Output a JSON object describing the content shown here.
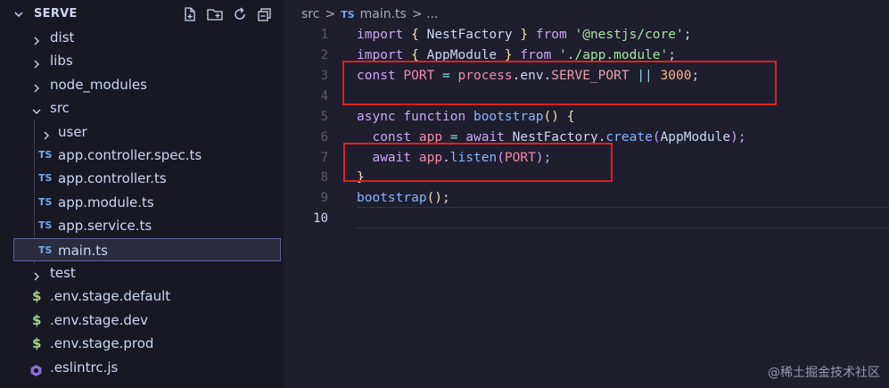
{
  "sidebar": {
    "title": "SERVE",
    "actions": [
      "new-file-icon",
      "new-folder-icon",
      "refresh-icon",
      "collapse-all-icon"
    ],
    "items": [
      {
        "label": "dist",
        "type": "folder",
        "expanded": false,
        "depth": 0
      },
      {
        "label": "libs",
        "type": "folder",
        "expanded": false,
        "depth": 0
      },
      {
        "label": "node_modules",
        "type": "folder",
        "expanded": false,
        "depth": 0
      },
      {
        "label": "src",
        "type": "folder",
        "expanded": true,
        "depth": 0
      },
      {
        "label": "user",
        "type": "folder",
        "expanded": false,
        "depth": 1
      },
      {
        "label": "app.controller.spec.ts",
        "type": "ts",
        "icon": "TS",
        "depth": 1
      },
      {
        "label": "app.controller.ts",
        "type": "ts",
        "icon": "TS",
        "depth": 1
      },
      {
        "label": "app.module.ts",
        "type": "ts",
        "icon": "TS",
        "depth": 1
      },
      {
        "label": "app.service.ts",
        "type": "ts",
        "icon": "TS",
        "depth": 1
      },
      {
        "label": "main.ts",
        "type": "ts",
        "icon": "TS",
        "depth": 1,
        "selected": true
      },
      {
        "label": "test",
        "type": "folder",
        "expanded": false,
        "depth": 0
      },
      {
        "label": ".env.stage.default",
        "type": "env",
        "icon": "$",
        "depth": 0
      },
      {
        "label": ".env.stage.dev",
        "type": "env",
        "icon": "$",
        "depth": 0
      },
      {
        "label": ".env.stage.prod",
        "type": "env",
        "icon": "$",
        "depth": 0
      },
      {
        "label": ".eslintrc.js",
        "type": "eslint",
        "depth": 0
      }
    ]
  },
  "breadcrumb": {
    "part1": "src",
    "sep": ">",
    "file_icon": "TS",
    "file": "main.ts",
    "tail": "> ..."
  },
  "editor": {
    "line_numbers": [
      "1",
      "2",
      "3",
      "4",
      "5",
      "6",
      "7",
      "8",
      "9",
      "10"
    ],
    "active_line": "10",
    "lines": {
      "l1": {
        "t1": "import",
        "t2": "{",
        "t3": "NestFactory",
        "t4": "}",
        "t5": "from",
        "t6": "'@nestjs/core'",
        "t7": ";"
      },
      "l2": {
        "t1": "import",
        "t2": "{",
        "t3": "AppModule",
        "t4": "}",
        "t5": "from",
        "t6": "'./app.module'",
        "t7": ";"
      },
      "l3": {
        "t1": "const",
        "t2": "PORT",
        "t3": "=",
        "t4": "process",
        "t5": ".env.",
        "t6": "SERVE_PORT",
        "t7": "||",
        "t8": "3000",
        "t9": ";"
      },
      "l5": {
        "t1": "async",
        "t2": "function",
        "t3": "bootstrap",
        "t4": "()",
        "t5": "{"
      },
      "l6": {
        "t1": "const",
        "t2": "app",
        "t3": "=",
        "t4": "await",
        "t5": "NestFactory",
        "t6": ".",
        "t7": "create",
        "t8": "(",
        "t9": "AppModule",
        "t10": ");"
      },
      "l7": {
        "t1": "await",
        "t2": "app",
        "t3": ".",
        "t4": "listen",
        "t5": "(",
        "t6": "PORT",
        "t7": ");"
      },
      "l8": {
        "t1": "}"
      },
      "l9": {
        "t1": "bootstrap",
        "t2": "();"
      }
    }
  },
  "watermark": "@稀土掘金技术社区",
  "colors": {
    "background": "#1e1e2e",
    "sidebar": "#181825",
    "highlight_box": "#e02020",
    "ts_icon": "#74a7e8",
    "env_icon": "#a6d189"
  }
}
